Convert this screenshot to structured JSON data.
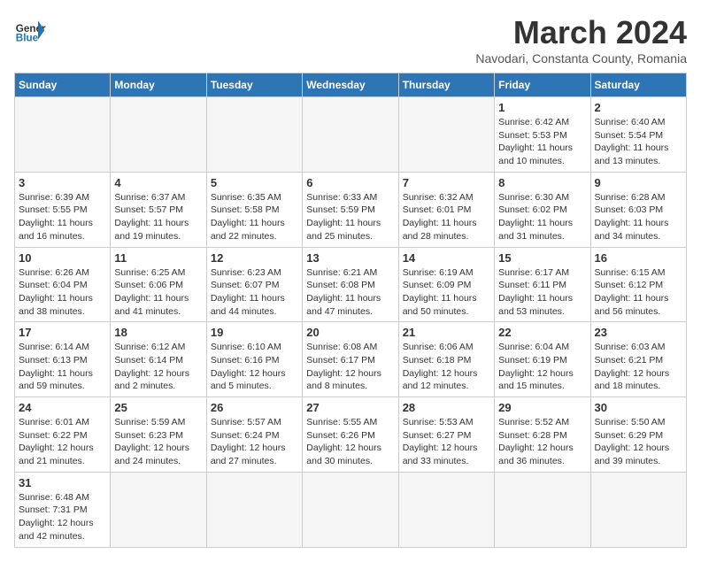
{
  "header": {
    "logo_general": "General",
    "logo_blue": "Blue",
    "month_title": "March 2024",
    "subtitle": "Navodari, Constanta County, Romania"
  },
  "weekdays": [
    "Sunday",
    "Monday",
    "Tuesday",
    "Wednesday",
    "Thursday",
    "Friday",
    "Saturday"
  ],
  "weeks": [
    [
      {
        "day": "",
        "empty": true
      },
      {
        "day": "",
        "empty": true
      },
      {
        "day": "",
        "empty": true
      },
      {
        "day": "",
        "empty": true
      },
      {
        "day": "",
        "empty": true
      },
      {
        "day": "1",
        "info": "Sunrise: 6:42 AM\nSunset: 5:53 PM\nDaylight: 11 hours and 10 minutes."
      },
      {
        "day": "2",
        "info": "Sunrise: 6:40 AM\nSunset: 5:54 PM\nDaylight: 11 hours and 13 minutes."
      }
    ],
    [
      {
        "day": "3",
        "info": "Sunrise: 6:39 AM\nSunset: 5:55 PM\nDaylight: 11 hours and 16 minutes."
      },
      {
        "day": "4",
        "info": "Sunrise: 6:37 AM\nSunset: 5:57 PM\nDaylight: 11 hours and 19 minutes."
      },
      {
        "day": "5",
        "info": "Sunrise: 6:35 AM\nSunset: 5:58 PM\nDaylight: 11 hours and 22 minutes."
      },
      {
        "day": "6",
        "info": "Sunrise: 6:33 AM\nSunset: 5:59 PM\nDaylight: 11 hours and 25 minutes."
      },
      {
        "day": "7",
        "info": "Sunrise: 6:32 AM\nSunset: 6:01 PM\nDaylight: 11 hours and 28 minutes."
      },
      {
        "day": "8",
        "info": "Sunrise: 6:30 AM\nSunset: 6:02 PM\nDaylight: 11 hours and 31 minutes."
      },
      {
        "day": "9",
        "info": "Sunrise: 6:28 AM\nSunset: 6:03 PM\nDaylight: 11 hours and 34 minutes."
      }
    ],
    [
      {
        "day": "10",
        "info": "Sunrise: 6:26 AM\nSunset: 6:04 PM\nDaylight: 11 hours and 38 minutes."
      },
      {
        "day": "11",
        "info": "Sunrise: 6:25 AM\nSunset: 6:06 PM\nDaylight: 11 hours and 41 minutes."
      },
      {
        "day": "12",
        "info": "Sunrise: 6:23 AM\nSunset: 6:07 PM\nDaylight: 11 hours and 44 minutes."
      },
      {
        "day": "13",
        "info": "Sunrise: 6:21 AM\nSunset: 6:08 PM\nDaylight: 11 hours and 47 minutes."
      },
      {
        "day": "14",
        "info": "Sunrise: 6:19 AM\nSunset: 6:09 PM\nDaylight: 11 hours and 50 minutes."
      },
      {
        "day": "15",
        "info": "Sunrise: 6:17 AM\nSunset: 6:11 PM\nDaylight: 11 hours and 53 minutes."
      },
      {
        "day": "16",
        "info": "Sunrise: 6:15 AM\nSunset: 6:12 PM\nDaylight: 11 hours and 56 minutes."
      }
    ],
    [
      {
        "day": "17",
        "info": "Sunrise: 6:14 AM\nSunset: 6:13 PM\nDaylight: 11 hours and 59 minutes."
      },
      {
        "day": "18",
        "info": "Sunrise: 6:12 AM\nSunset: 6:14 PM\nDaylight: 12 hours and 2 minutes."
      },
      {
        "day": "19",
        "info": "Sunrise: 6:10 AM\nSunset: 6:16 PM\nDaylight: 12 hours and 5 minutes."
      },
      {
        "day": "20",
        "info": "Sunrise: 6:08 AM\nSunset: 6:17 PM\nDaylight: 12 hours and 8 minutes."
      },
      {
        "day": "21",
        "info": "Sunrise: 6:06 AM\nSunset: 6:18 PM\nDaylight: 12 hours and 12 minutes."
      },
      {
        "day": "22",
        "info": "Sunrise: 6:04 AM\nSunset: 6:19 PM\nDaylight: 12 hours and 15 minutes."
      },
      {
        "day": "23",
        "info": "Sunrise: 6:03 AM\nSunset: 6:21 PM\nDaylight: 12 hours and 18 minutes."
      }
    ],
    [
      {
        "day": "24",
        "info": "Sunrise: 6:01 AM\nSunset: 6:22 PM\nDaylight: 12 hours and 21 minutes."
      },
      {
        "day": "25",
        "info": "Sunrise: 5:59 AM\nSunset: 6:23 PM\nDaylight: 12 hours and 24 minutes."
      },
      {
        "day": "26",
        "info": "Sunrise: 5:57 AM\nSunset: 6:24 PM\nDaylight: 12 hours and 27 minutes."
      },
      {
        "day": "27",
        "info": "Sunrise: 5:55 AM\nSunset: 6:26 PM\nDaylight: 12 hours and 30 minutes."
      },
      {
        "day": "28",
        "info": "Sunrise: 5:53 AM\nSunset: 6:27 PM\nDaylight: 12 hours and 33 minutes."
      },
      {
        "day": "29",
        "info": "Sunrise: 5:52 AM\nSunset: 6:28 PM\nDaylight: 12 hours and 36 minutes."
      },
      {
        "day": "30",
        "info": "Sunrise: 5:50 AM\nSunset: 6:29 PM\nDaylight: 12 hours and 39 minutes."
      }
    ],
    [
      {
        "day": "31",
        "info": "Sunrise: 6:48 AM\nSunset: 7:31 PM\nDaylight: 12 hours and 42 minutes."
      },
      {
        "day": "",
        "empty": true
      },
      {
        "day": "",
        "empty": true
      },
      {
        "day": "",
        "empty": true
      },
      {
        "day": "",
        "empty": true
      },
      {
        "day": "",
        "empty": true
      },
      {
        "day": "",
        "empty": true
      }
    ]
  ]
}
